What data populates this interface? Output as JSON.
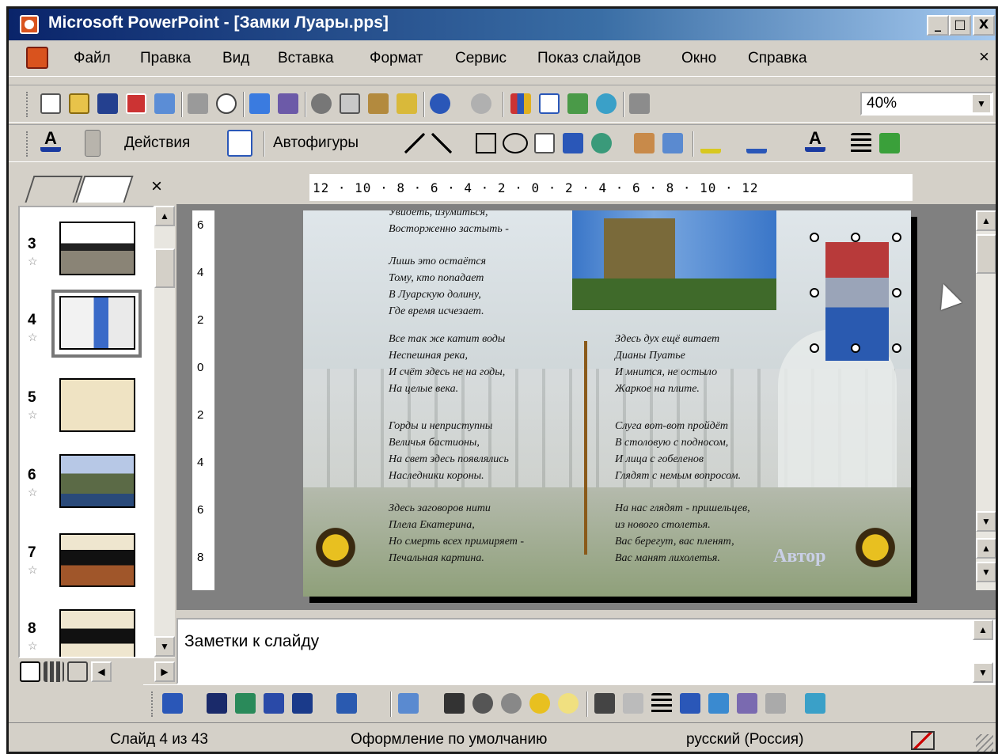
{
  "window": {
    "title": "Microsoft PowerPoint - [Замки Луары.pps]",
    "minimize": "_",
    "maximize": "□",
    "close": "X"
  },
  "menu": {
    "items": [
      "Файл",
      "Правка",
      "Вид",
      "Вставка",
      "Формат",
      "Сервис",
      "Показ слайдов",
      "Окно",
      "Справка"
    ],
    "close": "×"
  },
  "toolbar": {
    "zoom": "40%"
  },
  "drawing_toolbar": {
    "actions_label": "Действия",
    "autoshapes_label": "Автофигуры"
  },
  "panel": {
    "close": "×",
    "slides": [
      {
        "number": "3"
      },
      {
        "number": "4"
      },
      {
        "number": "5"
      },
      {
        "number": "6"
      },
      {
        "number": "7"
      },
      {
        "number": "8"
      }
    ]
  },
  "ruler": {
    "horizontal": "12 · 10 · 8 · 6 · 4 · 2 · 0 · 2 · 4 · 6 · 8 · 10 · 12",
    "vertical": [
      "6",
      "4",
      "2",
      "0",
      "2",
      "4",
      "6",
      "8"
    ]
  },
  "slide": {
    "top_lines": [
      "Увидеть, изумиться,",
      "Восторженно застыть -"
    ],
    "stanza1": [
      "Лишь это остаётся",
      "Тому, кто попадает",
      "В Луарскую долину,",
      "Где время исчезает."
    ],
    "stanza2": [
      "Все так же катит воды",
      "Неспешная река,",
      "И счёт здесь не на годы,",
      "На целые века."
    ],
    "stanza3": [
      "Горды и неприступны",
      "Величья бастионы,",
      "На свет здесь появлялись",
      "Наследники короны."
    ],
    "stanza4": [
      "Здесь заговоров нити",
      "Плела Екатерина,",
      "Но смерть всех примиряет -",
      "Печальная картина."
    ],
    "stanza5": [
      "Здесь дух ещё витает",
      "Дианы Пуатье",
      "И мнится, не остыло",
      "Жаркое на плите."
    ],
    "stanza6": [
      "Слуга вот-вот пройдёт",
      "В столовую с подносом,",
      "И лица с гобеленов",
      "Глядят с немым вопросом."
    ],
    "stanza7": [
      "На нас глядят - пришельцев,",
      "из нового столетья.",
      "Вас берегут, вас пленят,",
      "Вас манят лихолетья."
    ],
    "author_link": "Автор"
  },
  "notes": {
    "placeholder": "Заметки к слайду"
  },
  "status": {
    "slide": "Слайд 4 из 43",
    "design": "Оформление по умолчанию",
    "language": "русский (Россия)"
  }
}
